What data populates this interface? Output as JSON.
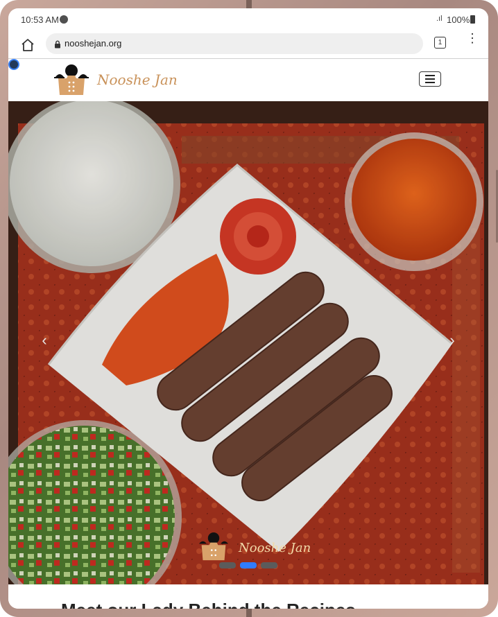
{
  "status_bar": {
    "time": "10:53 AM",
    "signal": ".ıl",
    "battery_text": "100%"
  },
  "browser": {
    "url": "nooshejan.org",
    "tab_count": "1"
  },
  "site": {
    "brand_name": "Nooshe Jan",
    "brand_color": "#c9925a"
  },
  "carousel": {
    "caption_brand": "Nooshe Jan",
    "prev_glyph": "‹",
    "next_glyph": "›",
    "indicator_count": 3,
    "active_index": 1,
    "active_color": "#2f7cff"
  },
  "below": {
    "heading": "Meet our Lady Behind the Recipes"
  }
}
